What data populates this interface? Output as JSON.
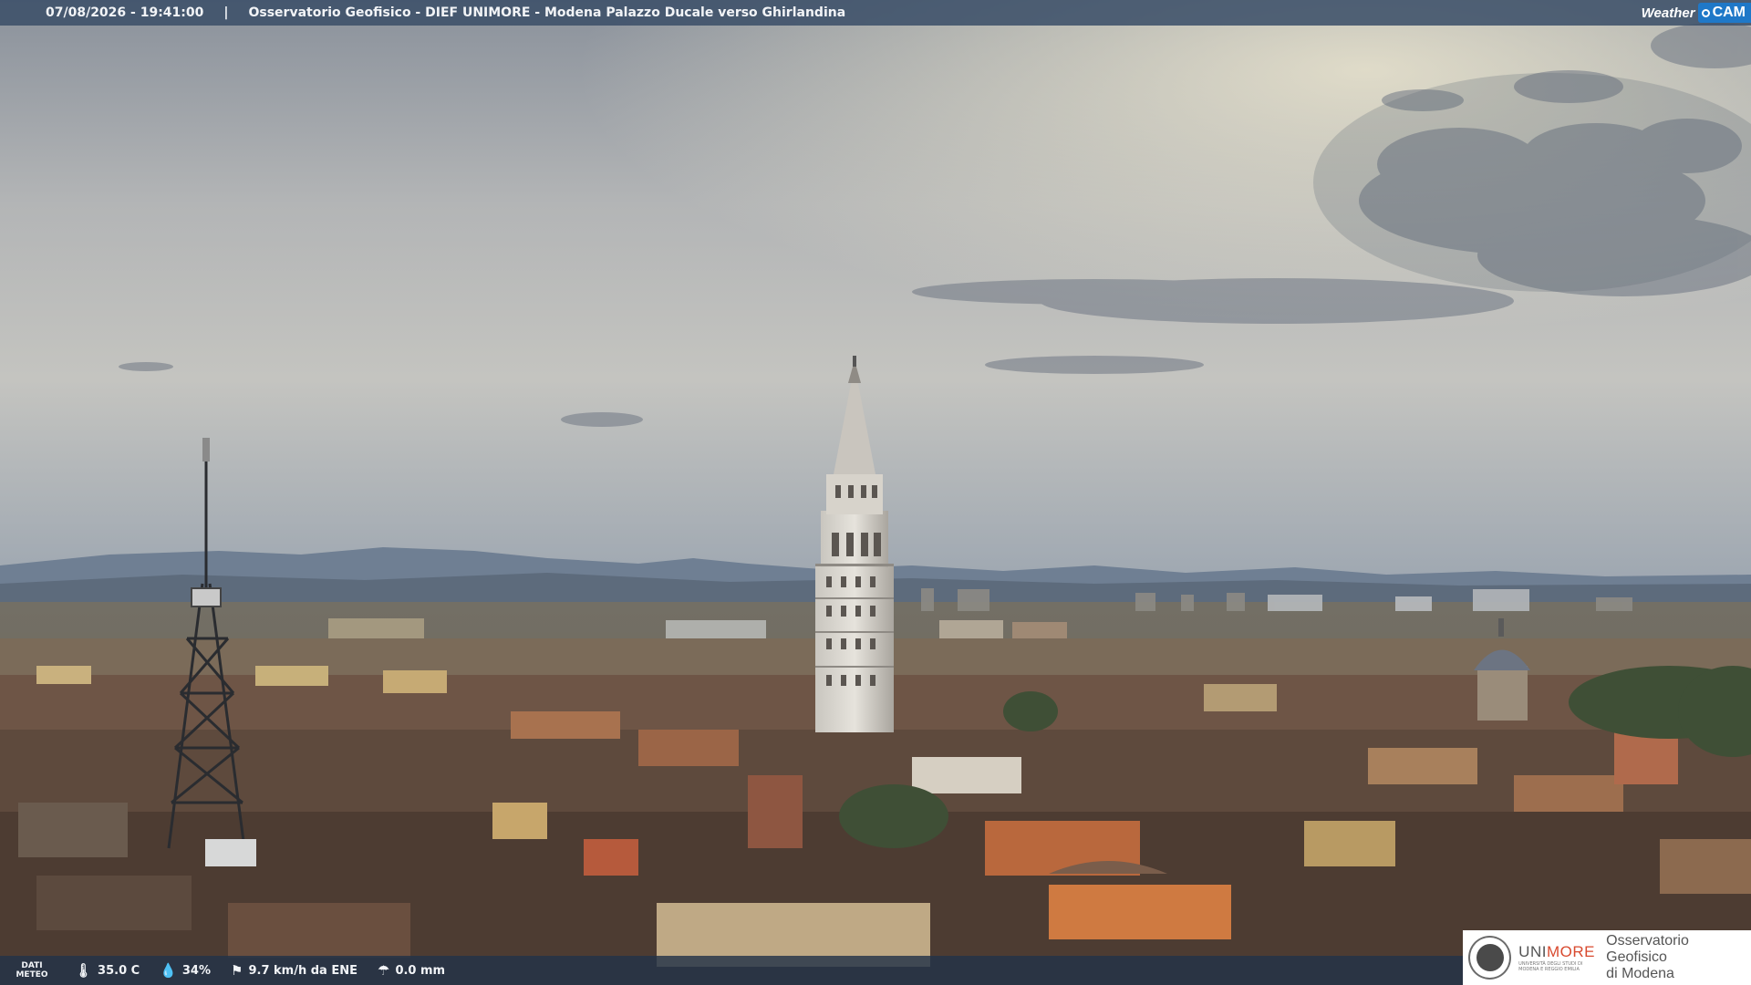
{
  "overlay": {
    "timestamp": "07/08/2026 - 19:41:00",
    "separator": "|",
    "caption": "Osservatorio Geofisico - DIEF UNIMORE - Modena Palazzo Ducale verso Ghirlandina",
    "brand_weather": "Weather",
    "brand_cam": "CAM"
  },
  "weather": {
    "label_line1": "DATI",
    "label_line2": "METEO",
    "temperature": "35.0 C",
    "humidity": "34%",
    "wind": "9.7 km/h da ENE",
    "rain": "0.0 mm",
    "icons": [
      "thermometer-icon",
      "humidity-drop-icon",
      "wind-sock-icon",
      "rain-gauge-icon"
    ]
  },
  "logo": {
    "uni_prefix": "UNI",
    "uni_suffix": "MORE",
    "uni_subtitle": "UNIVERSITÀ DEGLI STUDI DI MODENA E REGGIO EMILIA",
    "observatory_line1": "Osservatorio Geofisico",
    "observatory_line2": "di Modena"
  },
  "colors": {
    "topbar": "#3a4e68",
    "brand_blue": "#1f78c8",
    "unimore_red": "#d84a2f"
  }
}
